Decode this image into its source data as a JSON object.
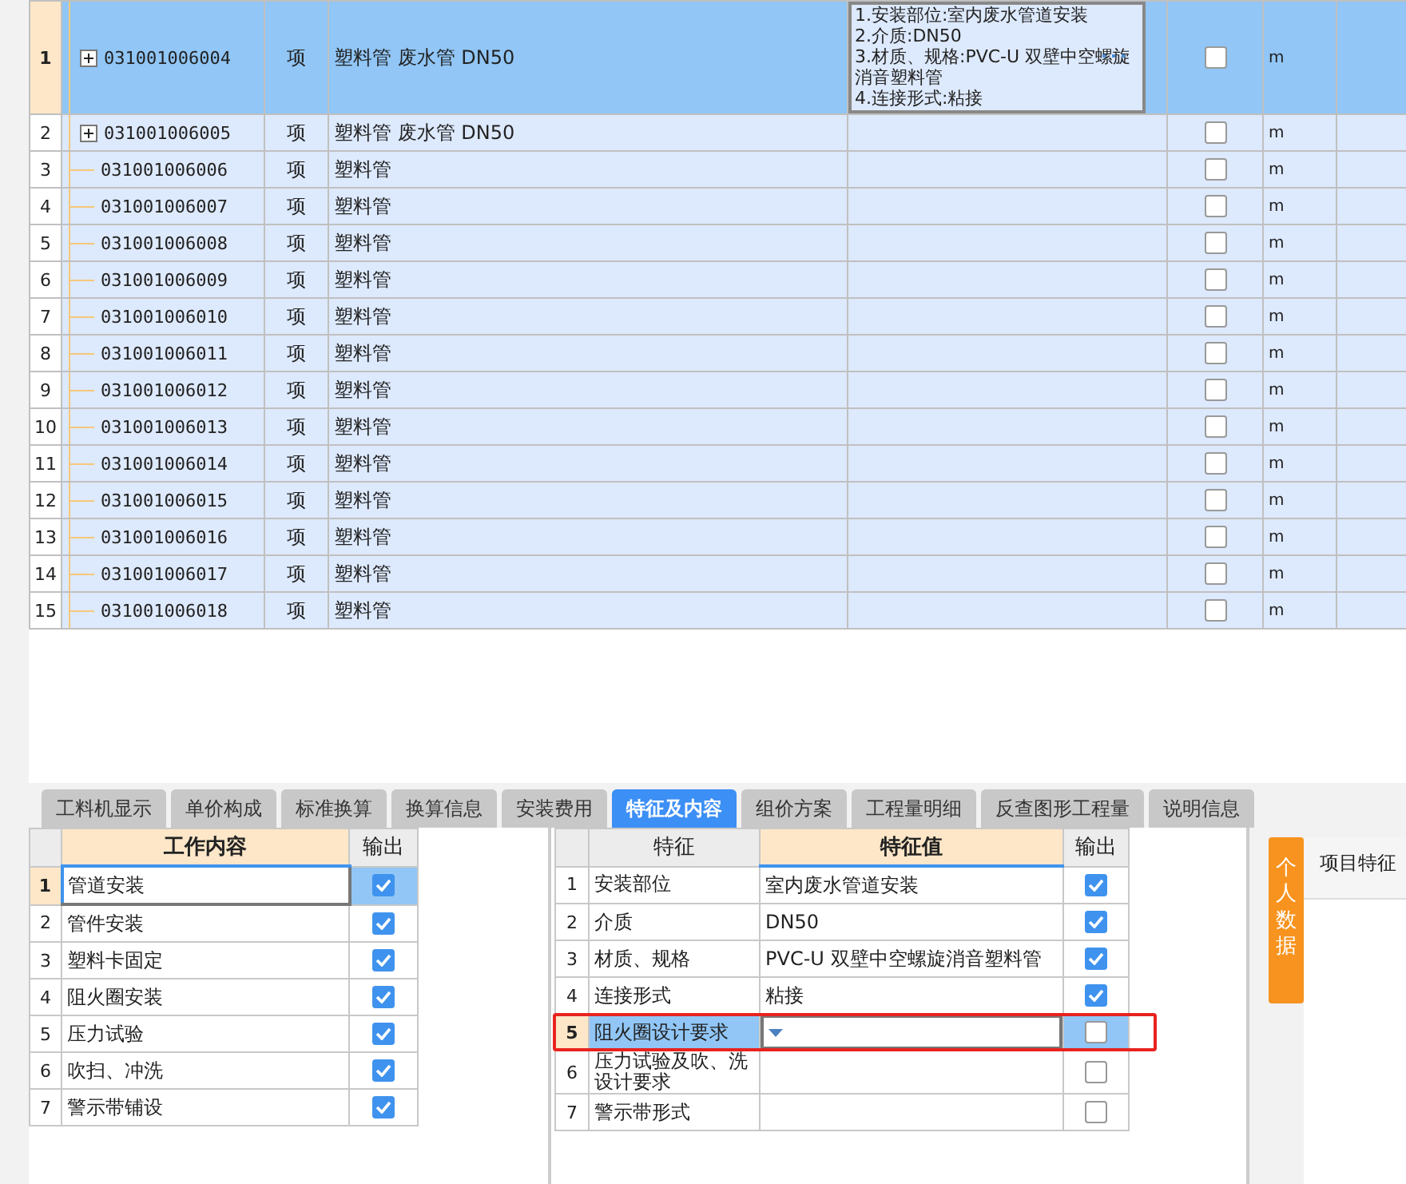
{
  "bill_grid": {
    "rows": [
      {
        "number": "1",
        "kind": "parent",
        "expanded": false,
        "selected": true,
        "code": "031001006004",
        "type": "项",
        "name": "塑料管 废水管 DN50",
        "features": [
          "1.安装部位:室内废水管道安装",
          "2.介质:DN50",
          "3.材质、规格:PVC-U 双壁中空螺旋消音塑料管",
          "4.连接形式:粘接"
        ],
        "checked": false,
        "unit": "m"
      },
      {
        "number": "2",
        "kind": "parent",
        "expanded": false,
        "selected": false,
        "code": "031001006005",
        "type": "项",
        "name": "塑料管 废水管 DN50",
        "checked": false,
        "unit": "m"
      },
      {
        "number": "3",
        "kind": "leaf",
        "selected": false,
        "code": "031001006006",
        "type": "项",
        "name": "塑料管",
        "checked": false,
        "unit": "m"
      },
      {
        "number": "4",
        "kind": "leaf",
        "selected": false,
        "code": "031001006007",
        "type": "项",
        "name": "塑料管",
        "checked": false,
        "unit": "m"
      },
      {
        "number": "5",
        "kind": "leaf",
        "selected": false,
        "code": "031001006008",
        "type": "项",
        "name": "塑料管",
        "checked": false,
        "unit": "m"
      },
      {
        "number": "6",
        "kind": "leaf",
        "selected": false,
        "code": "031001006009",
        "type": "项",
        "name": "塑料管",
        "checked": false,
        "unit": "m"
      },
      {
        "number": "7",
        "kind": "leaf",
        "selected": false,
        "code": "031001006010",
        "type": "项",
        "name": "塑料管",
        "checked": false,
        "unit": "m"
      },
      {
        "number": "8",
        "kind": "leaf",
        "selected": false,
        "code": "031001006011",
        "type": "项",
        "name": "塑料管",
        "checked": false,
        "unit": "m"
      },
      {
        "number": "9",
        "kind": "leaf",
        "selected": false,
        "code": "031001006012",
        "type": "项",
        "name": "塑料管",
        "checked": false,
        "unit": "m"
      },
      {
        "number": "10",
        "kind": "leaf",
        "selected": false,
        "code": "031001006013",
        "type": "项",
        "name": "塑料管",
        "checked": false,
        "unit": "m"
      },
      {
        "number": "11",
        "kind": "leaf",
        "selected": false,
        "code": "031001006014",
        "type": "项",
        "name": "塑料管",
        "checked": false,
        "unit": "m"
      },
      {
        "number": "12",
        "kind": "leaf",
        "selected": false,
        "code": "031001006015",
        "type": "项",
        "name": "塑料管",
        "checked": false,
        "unit": "m"
      },
      {
        "number": "13",
        "kind": "leaf",
        "selected": false,
        "code": "031001006016",
        "type": "项",
        "name": "塑料管",
        "checked": false,
        "unit": "m"
      },
      {
        "number": "14",
        "kind": "leaf",
        "selected": false,
        "code": "031001006017",
        "type": "项",
        "name": "塑料管",
        "checked": false,
        "unit": "m"
      },
      {
        "number": "15",
        "kind": "leaf",
        "selected": false,
        "code": "031001006018",
        "type": "项",
        "name": "塑料管",
        "checked": false,
        "unit": "m"
      }
    ]
  },
  "tabs": [
    {
      "label": "工料机显示",
      "selected": false
    },
    {
      "label": "单价构成",
      "selected": false
    },
    {
      "label": "标准换算",
      "selected": false
    },
    {
      "label": "换算信息",
      "selected": false
    },
    {
      "label": "安装费用",
      "selected": false
    },
    {
      "label": "特征及内容",
      "selected": true
    },
    {
      "label": "组价方案",
      "selected": false
    },
    {
      "label": "工程量明细",
      "selected": false
    },
    {
      "label": "反查图形工程量",
      "selected": false
    },
    {
      "label": "说明信息",
      "selected": false
    }
  ],
  "work_content": {
    "columns": [
      {
        "label": "工作内容",
        "selected": true
      },
      {
        "label": "输出",
        "selected": false
      }
    ],
    "rows": [
      {
        "number": "1",
        "text": "管道安装",
        "checked": true,
        "selected": true
      },
      {
        "number": "2",
        "text": "管件安装",
        "checked": true,
        "selected": false
      },
      {
        "number": "3",
        "text": "塑料卡固定",
        "checked": true,
        "selected": false
      },
      {
        "number": "4",
        "text": "阻火圈安装",
        "checked": true,
        "selected": false
      },
      {
        "number": "5",
        "text": "压力试验",
        "checked": true,
        "selected": false
      },
      {
        "number": "6",
        "text": "吹扫、冲洗",
        "checked": true,
        "selected": false
      },
      {
        "number": "7",
        "text": "警示带铺设",
        "checked": true,
        "selected": false
      }
    ]
  },
  "features": {
    "columns": [
      {
        "label": "特征",
        "selected": false
      },
      {
        "label": "特征值",
        "selected": true
      },
      {
        "label": "输出",
        "selected": false
      }
    ],
    "rows": [
      {
        "number": "1",
        "feature": "安装部位",
        "value": "室内废水管道安装",
        "checked": true,
        "selected": false,
        "highlighted": false
      },
      {
        "number": "2",
        "feature": "介质",
        "value": "DN50",
        "checked": true,
        "selected": false,
        "highlighted": false
      },
      {
        "number": "3",
        "feature": "材质、规格",
        "value": "PVC-U 双壁中空螺旋消音塑料管",
        "checked": true,
        "selected": false,
        "highlighted": false
      },
      {
        "number": "4",
        "feature": "连接形式",
        "value": "粘接",
        "checked": true,
        "selected": false,
        "highlighted": false
      },
      {
        "number": "5",
        "feature": "阻火圈设计要求",
        "checked": false,
        "selected": true,
        "highlighted": true
      },
      {
        "number": "6",
        "feature": "压力试验及吹、洗设计要求",
        "checked": false,
        "selected": false,
        "highlighted": false
      },
      {
        "number": "7",
        "feature": "警示带形式",
        "checked": false,
        "selected": false,
        "highlighted": false
      }
    ]
  },
  "side_tab": {
    "label": "个人数据"
  },
  "right_panel": {
    "header": "项目特征"
  }
}
